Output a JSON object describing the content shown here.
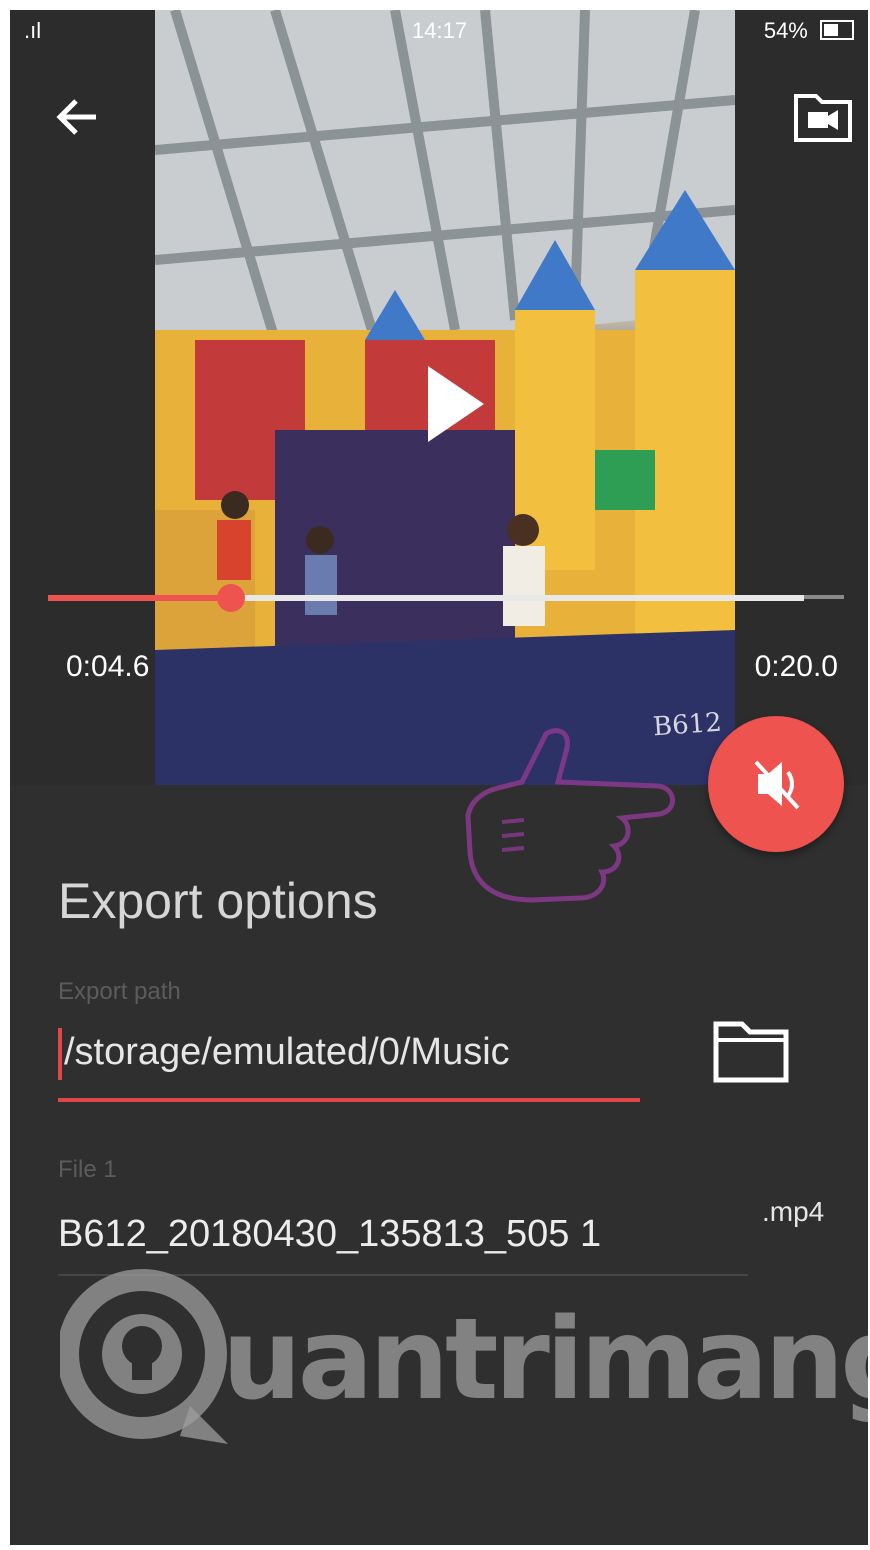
{
  "status_bar": {
    "signal": ".ıl",
    "time": "14:17",
    "battery_percent": "54%"
  },
  "player": {
    "current_time": "0:04.6",
    "total_time": "0:20.0",
    "progress_fraction": 0.23,
    "buffered_fraction": 0.95,
    "video_watermark": "B612"
  },
  "export": {
    "title": "Export options",
    "path_label": "Export path",
    "path_value": "/storage/emulated/0/Music",
    "file_label": "File 1",
    "file_value": "B612_20180430_135813_505 1",
    "file_extension": ".mp4"
  },
  "site_watermark": {
    "text": "uantrimang"
  },
  "colors": {
    "accent": "#ef5350",
    "background": "#2f2f2f"
  },
  "icons": {
    "back": "arrow-left-icon",
    "camera_folder": "video-folder-icon",
    "play": "play-icon",
    "mute": "volume-off-icon",
    "folder": "folder-icon"
  }
}
